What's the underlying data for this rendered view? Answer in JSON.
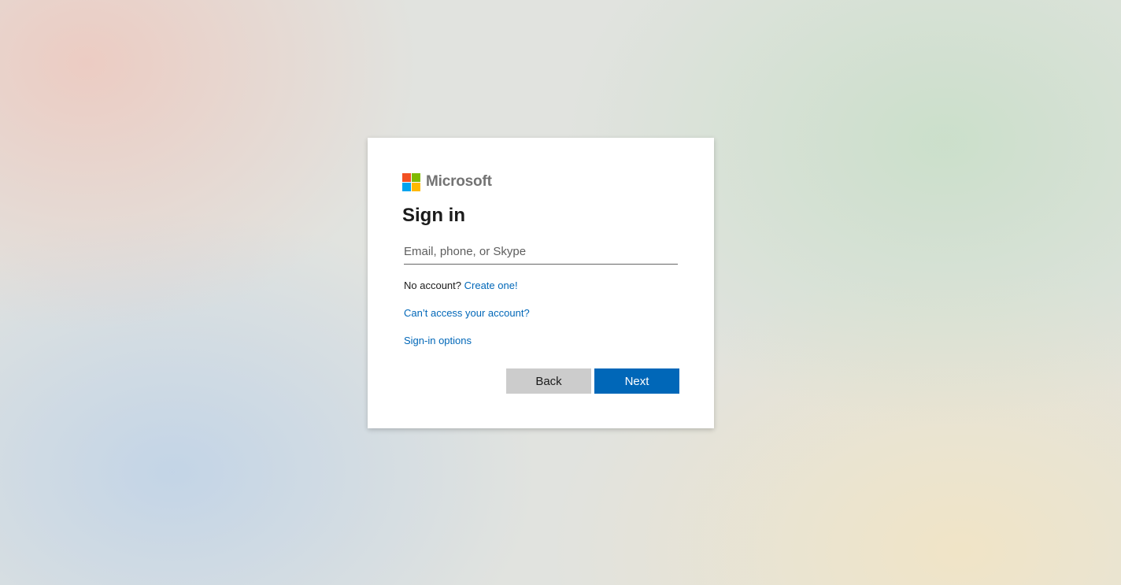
{
  "brand": {
    "name": "Microsoft",
    "colors": {
      "red": "#f25022",
      "green": "#7fba00",
      "blue": "#00a4ef",
      "yellow": "#ffb900"
    }
  },
  "signin": {
    "title": "Sign in",
    "email_placeholder": "Email, phone, or Skype",
    "email_value": "",
    "no_account_text": "No account?",
    "create_link": "Create one!",
    "cant_access_link": "Can’t access your account?",
    "signin_options_link": "Sign-in options"
  },
  "buttons": {
    "back_label": "Back",
    "next_label": "Next"
  },
  "theme": {
    "accent": "#0067b8",
    "secondary_button": "#cccccc"
  }
}
